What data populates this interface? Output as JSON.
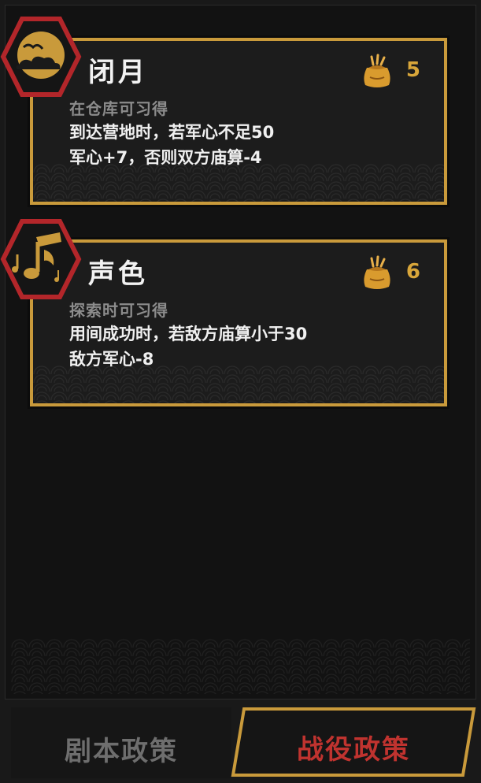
{
  "cards": [
    {
      "title": "闭月",
      "source": "在仓库可习得",
      "desc_line1": "到达营地时，若军心不足50",
      "desc_line2": "军心+7，否则双方庙算-4",
      "cost": "5",
      "icon": "moon-cloud-icon",
      "cost_icon": "grain-sack-icon"
    },
    {
      "title": "声色",
      "source": "探索时可习得",
      "desc_line1": "用间成功时，若敌方庙算小于30",
      "desc_line2": "敌方军心-8",
      "cost": "6",
      "icon": "music-note-icon",
      "cost_icon": "grain-sack-icon"
    }
  ],
  "tabs": {
    "left_label": "剧本政策",
    "right_label": "战役政策",
    "active": "战役政策"
  },
  "colors": {
    "accent_gold": "#c99a3b",
    "hex_red": "#b3262a",
    "active_tab_text": "#c0332f",
    "inactive_tab_text": "#6e6e6e"
  }
}
